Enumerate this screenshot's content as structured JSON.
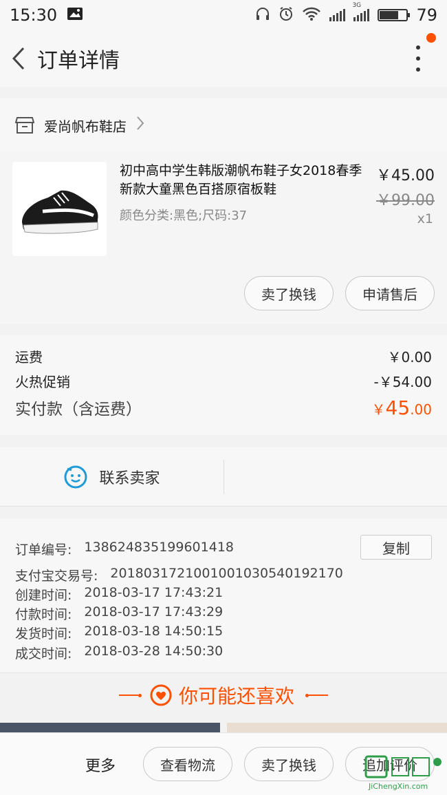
{
  "status_bar": {
    "time": "15:30",
    "network": "3G",
    "battery_level": "79",
    "battery_fraction": 0.7
  },
  "nav": {
    "title": "订单详情"
  },
  "shop": {
    "name": "爱尚帆布鞋店"
  },
  "item": {
    "title": "初中高中学生韩版潮帆布鞋子女2018春季新款大童黑色百搭原宿板鞋",
    "spec": "颜色分类:黑色;尺码:37",
    "price": "￥45.00",
    "original_price": "￥99.00",
    "quantity": "x1",
    "buttons": {
      "sell": "卖了换钱",
      "after_sale": "申请售后"
    }
  },
  "fees": {
    "shipping_label": "运费",
    "shipping_value": "￥0.00",
    "promo_label": "火热促销",
    "promo_value": "-￥54.00",
    "total_label": "实付款（含运费）",
    "total_currency": "￥",
    "total_int": "45",
    "total_dec": ".00",
    "accent_color": "#ff5000"
  },
  "contact": {
    "label": "联系卖家"
  },
  "order_info": {
    "copy_label": "复制",
    "rows": [
      {
        "k": "订单编号:",
        "v": "138624835199601418"
      },
      {
        "k": "支付宝交易号:",
        "v": "2018031721001001030540192170"
      },
      {
        "k": "创建时间:",
        "v": "2018-03-17 17:43:21"
      },
      {
        "k": "付款时间:",
        "v": "2018-03-17 17:43:29"
      },
      {
        "k": "发货时间:",
        "v": "2018-03-18 14:50:15"
      },
      {
        "k": "成交时间:",
        "v": "2018-03-28 14:50:30"
      }
    ]
  },
  "recommend": {
    "label": "你可能还喜欢"
  },
  "bottom_bar": {
    "more": "更多",
    "logistics": "查看物流",
    "sell": "卖了换钱",
    "review": "追加评价"
  },
  "watermark": {
    "text": "JiChengXin.com"
  }
}
